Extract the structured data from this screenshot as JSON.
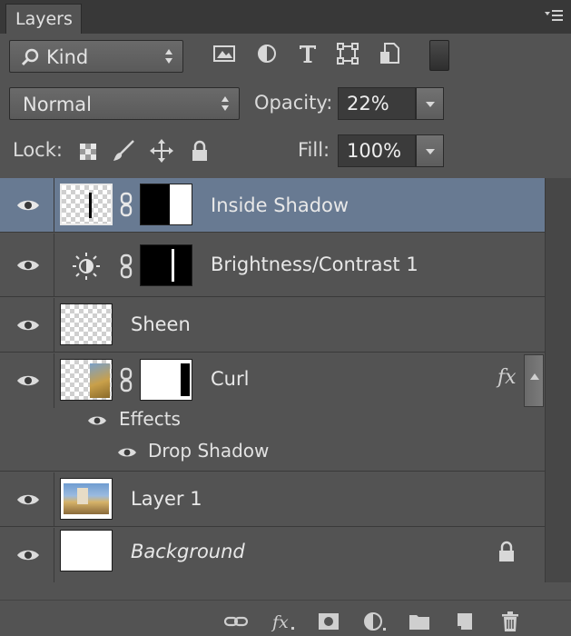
{
  "panel": {
    "tab_label": "Layers"
  },
  "filter": {
    "kind_label": "Kind"
  },
  "blend": {
    "mode_label": "Normal",
    "opacity_label": "Opacity:",
    "opacity_value": "22%"
  },
  "lock": {
    "lock_label": "Lock:",
    "fill_label": "Fill:",
    "fill_value": "100%"
  },
  "layers": [
    {
      "name": "Inside Shadow",
      "selected": true,
      "visible": true
    },
    {
      "name": "Brightness/Contrast 1",
      "selected": false,
      "visible": true
    },
    {
      "name": "Sheen",
      "selected": false,
      "visible": true
    },
    {
      "name": "Curl",
      "selected": false,
      "visible": true,
      "fx": "fx",
      "effects_label": "Effects",
      "effects": [
        "Drop Shadow"
      ]
    },
    {
      "name": "Layer 1",
      "selected": false,
      "visible": true
    },
    {
      "name": "Background",
      "selected": false,
      "visible": true,
      "locked": true
    }
  ],
  "colors": {
    "selected_row": "#687a92",
    "panel_bg": "#535353",
    "tab_bar": "#383838"
  }
}
